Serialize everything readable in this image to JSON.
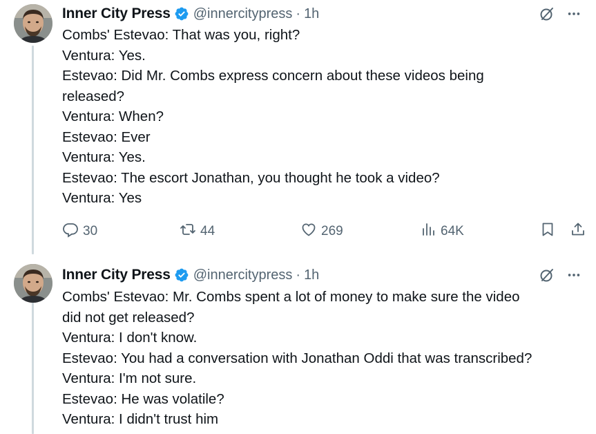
{
  "tweets": [
    {
      "author": {
        "name": "Inner City Press",
        "handle": "@innercitypress",
        "separator": "·",
        "time": "1h"
      },
      "lines": [
        "Combs' Estevao: That was you, right?",
        "Ventura: Yes.",
        "Estevao: Did Mr. Combs express concern about these videos being",
        "released?",
        "Ventura: When?",
        "Estevao: Ever",
        "Ventura: Yes.",
        "Estevao: The escort Jonathan, you thought he took a video?",
        "Ventura: Yes"
      ],
      "stats": {
        "replies": "30",
        "reposts": "44",
        "likes": "269",
        "views": "64K"
      }
    },
    {
      "author": {
        "name": "Inner City Press",
        "handle": "@innercitypress",
        "separator": "·",
        "time": "1h"
      },
      "lines": [
        "Combs' Estevao: Mr. Combs spent a lot of money to make sure the video",
        "did not get released?",
        "Ventura: I don't know.",
        "Estevao: You had a conversation with Jonathan Oddi that was transcribed?",
        "Ventura: I'm not sure.",
        "Estevao: He was volatile?",
        "Ventura: I didn't trust him"
      ]
    }
  ],
  "icons": {
    "verified": "verified-badge-icon",
    "grok": "grok-icon",
    "more": "more-icon",
    "reply": "reply-icon",
    "repost": "repost-icon",
    "like": "heart-icon",
    "views": "views-icon",
    "bookmark": "bookmark-icon",
    "share": "share-icon"
  },
  "colors": {
    "verified": "#1d9bf0",
    "text": "#0f1419",
    "muted": "#536471",
    "thread_line": "#cfd9de"
  }
}
